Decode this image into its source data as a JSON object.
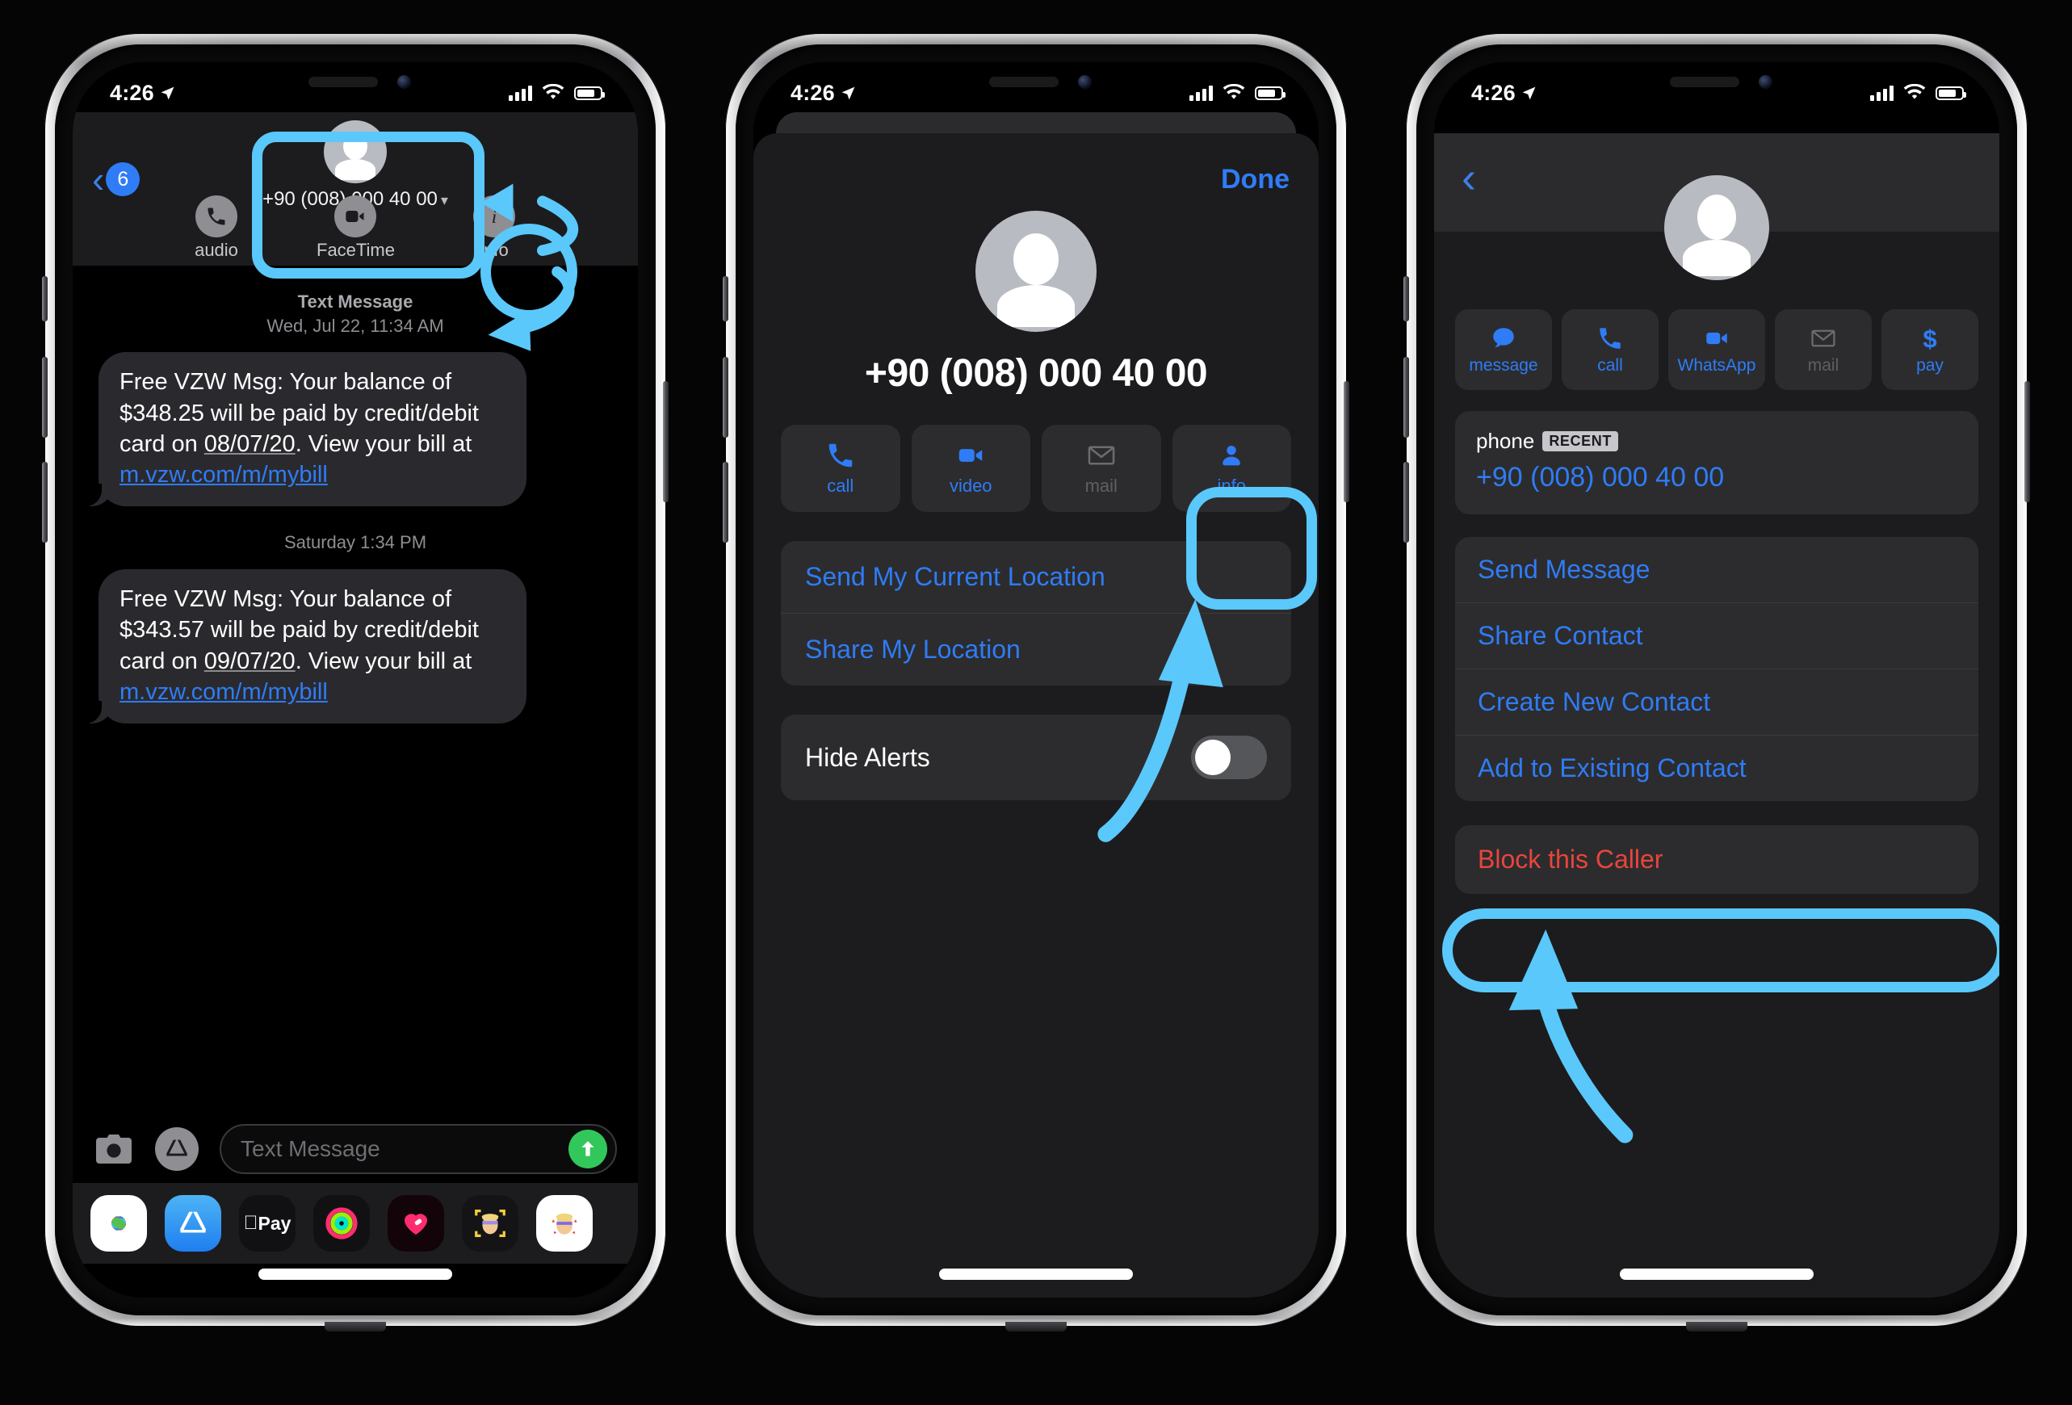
{
  "status_bar": {
    "time": "4:26"
  },
  "phone1": {
    "name": "messages-thread",
    "header": {
      "back_count": "6",
      "contact_name": "+90 (008) 000 40 00",
      "actions": [
        {
          "icon": "phone-icon",
          "label": "audio"
        },
        {
          "icon": "video-camera-icon",
          "label": "FaceTime"
        },
        {
          "icon": "info-icon",
          "label": "info"
        }
      ]
    },
    "thread": [
      {
        "stamp_title": "Text Message",
        "stamp_time": "Wed, Jul 22, 11:34 AM",
        "text_before": "Free VZW Msg: Your balance of $348.25 will be paid by credit/debit card on ",
        "date_underlined": "08/07/20",
        "text_mid": ". View your bill at ",
        "link": "m.vzw.com/m/mybill"
      },
      {
        "stamp_title": "",
        "stamp_time": "Saturday 1:34 PM",
        "text_before": "Free VZW Msg: Your balance of $343.57 will be paid by credit/debit card on ",
        "date_underlined": "09/07/20",
        "text_mid": ". View your bill at ",
        "link": "m.vzw.com/m/mybill"
      }
    ],
    "composer": {
      "placeholder": "Text Message"
    },
    "dock": [
      "photos-app-icon",
      "app-store-app-icon",
      "apple-pay-app-icon",
      "fitness-app-icon",
      "digital-touch-app-icon",
      "memoji-app-icon",
      "stickers-app-icon"
    ]
  },
  "phone2": {
    "name": "details-sheet",
    "done_label": "Done",
    "contact_name": "+90 (008) 000 40 00",
    "tiles": [
      {
        "icon": "phone-icon",
        "label": "call",
        "dim": false
      },
      {
        "icon": "video-camera-icon",
        "label": "video",
        "dim": false
      },
      {
        "icon": "mail-icon",
        "label": "mail",
        "dim": true
      },
      {
        "icon": "contact-person-icon",
        "label": "info",
        "dim": false
      }
    ],
    "location_rows": [
      "Send My Current Location",
      "Share My Location"
    ],
    "hide_alerts_label": "Hide Alerts",
    "hide_alerts_on": false
  },
  "phone3": {
    "name": "contact-card",
    "tiles": [
      {
        "icon": "message-bubble-icon",
        "label": "message",
        "dim": false
      },
      {
        "icon": "phone-icon",
        "label": "call",
        "dim": false
      },
      {
        "icon": "video-camera-icon",
        "label": "WhatsApp",
        "dim": false
      },
      {
        "icon": "mail-icon",
        "label": "mail",
        "dim": true
      },
      {
        "icon": "dollar-icon",
        "label": "pay",
        "dim": false
      }
    ],
    "phone_label": "phone",
    "phone_badge": "RECENT",
    "phone_number": "+90 (008) 000 40 00",
    "actions": [
      "Send Message",
      "Share Contact",
      "Create New Contact",
      "Add to Existing Contact"
    ],
    "block_label": "Block this Caller"
  },
  "annotations": {
    "highlight_color": "#5ac8fa",
    "items": [
      "header-contact-highlight",
      "info-button-highlight-phone1",
      "curved-arrow-to-header",
      "curved-arrow-to-info",
      "info-tile-highlight-phone2",
      "arrow-to-info-tile",
      "block-caller-highlight",
      "arrow-to-block-caller"
    ]
  }
}
